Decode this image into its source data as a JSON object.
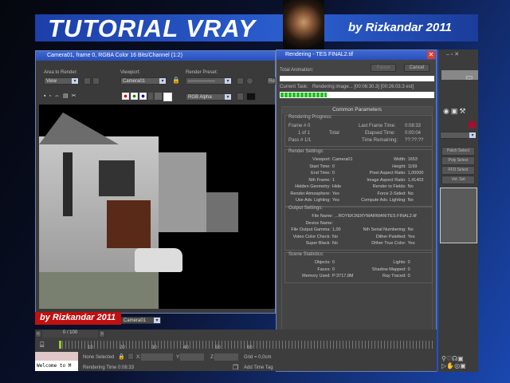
{
  "banner": {
    "title": "TUTORIAL VRAY",
    "byline": "by Rizkandar 2011"
  },
  "framebuffer": {
    "title": "Camera01, frame 0, RGBA Color 16 Bits/Channel (1:2)",
    "area_label": "Area to Render:",
    "area_value": "View",
    "viewport_label": "Viewport:",
    "viewport_value": "Camera01",
    "preset_label": "Render Preset:",
    "preset_value": "-----------------",
    "channel_value": "RGB Alpha",
    "render_btn": "Re",
    "camera_value": "Camera01"
  },
  "watermark": "by Rizkandar 2011",
  "dialog": {
    "title": "Rendering - TES FINAL2.tif",
    "total_animation": "Total Animation:",
    "pause": "Pause",
    "cancel": "Cancel",
    "current_task_label": "Current Task:",
    "current_task": "Rendering image... [00:06:30.3] [00:26:03.3 est]",
    "progress": 0.3,
    "common_params": "Common Parameters",
    "progress_group": {
      "title": "Rendering Progress:",
      "frame": "Frame #  0",
      "of": "1 of  1",
      "total": "Total",
      "pass": "Pass #  1/1",
      "last_frame_label": "Last Frame Time:",
      "last_frame": "0:08:33",
      "elapsed_label": "Elapsed Time:",
      "elapsed": "0:00:04",
      "remaining_label": "Time Remaining:",
      "remaining": "??:??:??"
    },
    "render_settings": {
      "title": "Render Settings:",
      "rows": [
        [
          "Viewport:",
          "Camera01",
          "Width:",
          "1653"
        ],
        [
          "Start Time:",
          "0",
          "Height:",
          "1169"
        ],
        [
          "End Time:",
          "0",
          "Pixel Aspect Ratio:",
          "1,00000"
        ],
        [
          "Nth Frame:",
          "1",
          "Image Aspect Ratio:",
          "1,41403"
        ],
        [
          "Hidden Geometry:",
          "Hide",
          "Render to Fields:",
          "No"
        ],
        [
          "Render Atmosphere:",
          "Yes",
          "Force 2-Sided:",
          "No"
        ],
        [
          "Use Adv. Lighting:",
          "Yes",
          "Compute Adv. Lighting:",
          "No"
        ]
      ]
    },
    "output_settings": {
      "title": "Output Settings:",
      "file_label": "File Name:",
      "file": "...ROYEK3\\ERYMARWAN\\TES FINAL2.tif",
      "device_label": "Device Name:",
      "rows": [
        [
          "File Output Gamma:",
          "1,00",
          "Nth Serial Numbering:",
          "No"
        ],
        [
          "Video Color Check:",
          "No",
          "Dither Paletted:",
          "Yes"
        ],
        [
          "Super Black:",
          "No",
          "Dither True Color:",
          "Yes"
        ]
      ]
    },
    "scene_stats": {
      "title": "Scene Statistics:",
      "rows": [
        [
          "Objects:",
          "0",
          "Lights:",
          "0"
        ],
        [
          "Faces:",
          "0",
          "Shadow Mapped:",
          "0"
        ],
        [
          "Memory Used:",
          "P:3717,8M",
          "Ray Traced:",
          "0"
        ]
      ]
    }
  },
  "right_panel": {
    "buttons": [
      "Patch Select",
      "Poly Select",
      "FFD Select",
      "Vol. Sel"
    ]
  },
  "timeline": {
    "position": "0 / 100",
    "ticks": [
      "10",
      "20",
      "30",
      "40",
      "50",
      "60"
    ]
  },
  "status": {
    "selection": "None Selected",
    "x_label": "X:",
    "y_label": "Y:",
    "z_label": "Z:",
    "grid": "Grid = 0,0cm",
    "render_time": "Rendering Time  0:08:33",
    "add_time_tag": "Add Time Tag",
    "welcome": "Welcome to M"
  }
}
